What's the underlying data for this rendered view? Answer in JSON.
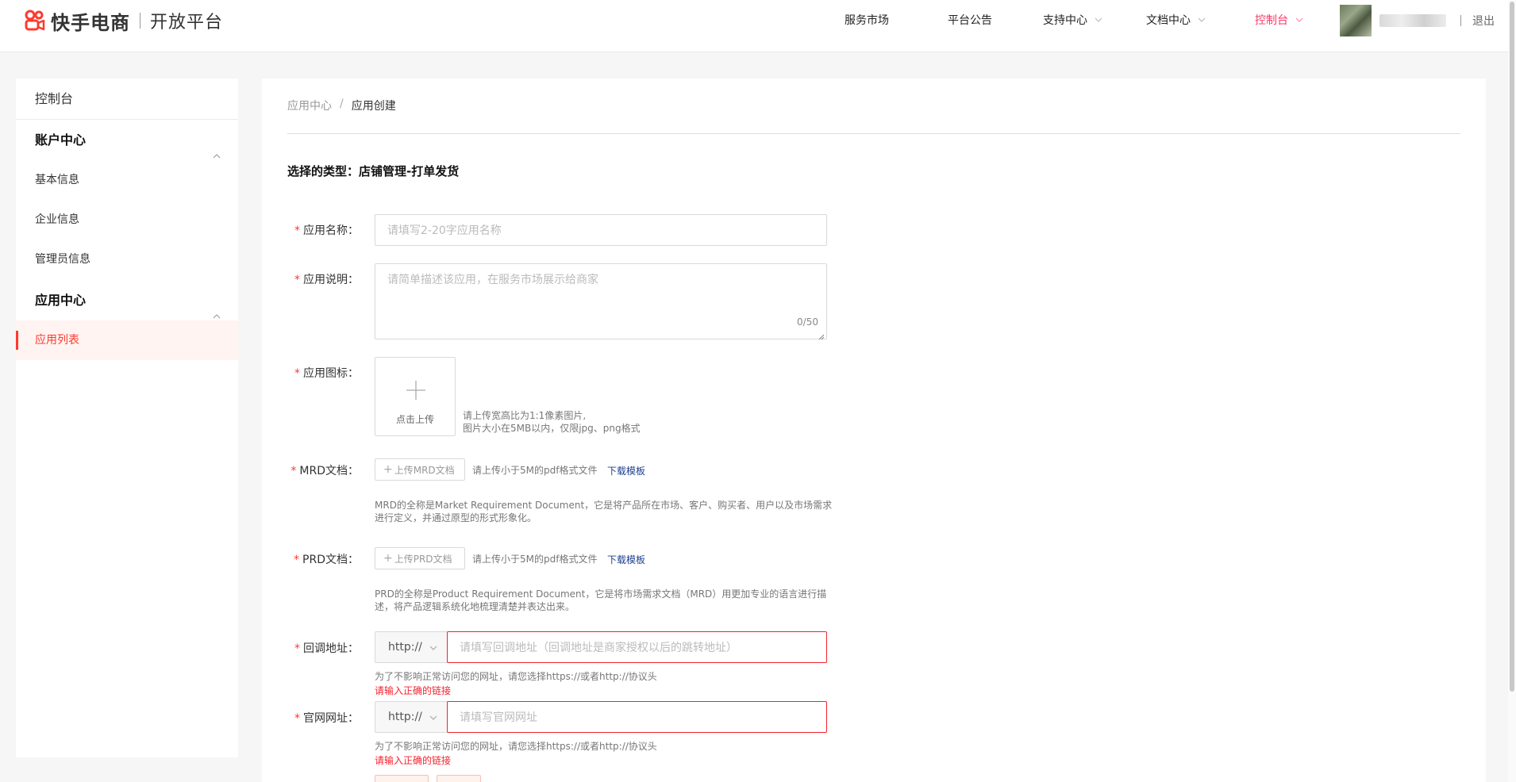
{
  "header": {
    "brand": "快手电商",
    "platform": "开放平台",
    "nav": [
      {
        "label": "服务市场",
        "has_dropdown": false,
        "active": false
      },
      {
        "label": "平台公告",
        "has_dropdown": false,
        "active": false
      },
      {
        "label": "支持中心",
        "has_dropdown": true,
        "active": false
      },
      {
        "label": "文档中心",
        "has_dropdown": true,
        "active": false
      },
      {
        "label": "控制台",
        "has_dropdown": true,
        "active": true
      }
    ],
    "logout": "退出",
    "accent_color": "#fe3666"
  },
  "sidebar": {
    "title": "控制台",
    "groups": [
      {
        "label": "账户中心",
        "items": [
          "基本信息",
          "企业信息",
          "管理员信息"
        ]
      },
      {
        "label": "应用中心",
        "items": [
          "应用列表"
        ]
      }
    ],
    "active_item": "应用列表"
  },
  "main": {
    "breadcrumb": [
      "应用中心",
      "应用创建"
    ],
    "breadcrumb_sep": "/",
    "type_line": "选择的类型：店铺管理-打单发货",
    "form": {
      "app_name": {
        "label": "应用名称：",
        "placeholder": "请填写2-20字应用名称"
      },
      "app_desc": {
        "label": "应用说明：",
        "placeholder": "请简单描述该应用，在服务市场展示给商家",
        "counter": "0/50"
      },
      "app_icon": {
        "label": "应用图标：",
        "upload_text": "点击上传",
        "hint_line1": "请上传宽高比为1:1像素图片,",
        "hint_line2": "图片大小在5MB以内，仅限jpg、png格式"
      },
      "mrd": {
        "label": "MRD文档：",
        "button": "上传MRD文档",
        "hint": "请上传小于5M的pdf格式文件",
        "link": "下载模板",
        "desc_line1": "MRD的全称是Market Requirement Document，它是将产品所在市场、客户、购买者、用户以及市场需求",
        "desc_line2": "进行定义，并通过原型的形式形象化。"
      },
      "prd": {
        "label": "PRD文档：",
        "button": "上传PRD文档",
        "hint": "请上传小于5M的pdf格式文件",
        "link": "下载模板",
        "desc_line1": "PRD的全称是Product Requirement Document，它是将市场需求文档（MRD）用更加专业的语言进行描",
        "desc_line2": "述，将产品逻辑系统化地梳理清楚并表达出来。"
      },
      "callback": {
        "label": "回调地址：",
        "protocol": "http://",
        "placeholder": "请填写回调地址（回调地址是商家授权以后的跳转地址）",
        "hint": "为了不影响正常访问您的网址，请您选择https://或者http://协议头",
        "error": "请输入正确的链接"
      },
      "website": {
        "label": "官网网址：",
        "protocol": "http://",
        "placeholder": "请填写官网网址",
        "hint": "为了不影响正常访问您的网址，请您选择https://或者http://协议头",
        "error": "请输入正确的链接"
      }
    }
  }
}
